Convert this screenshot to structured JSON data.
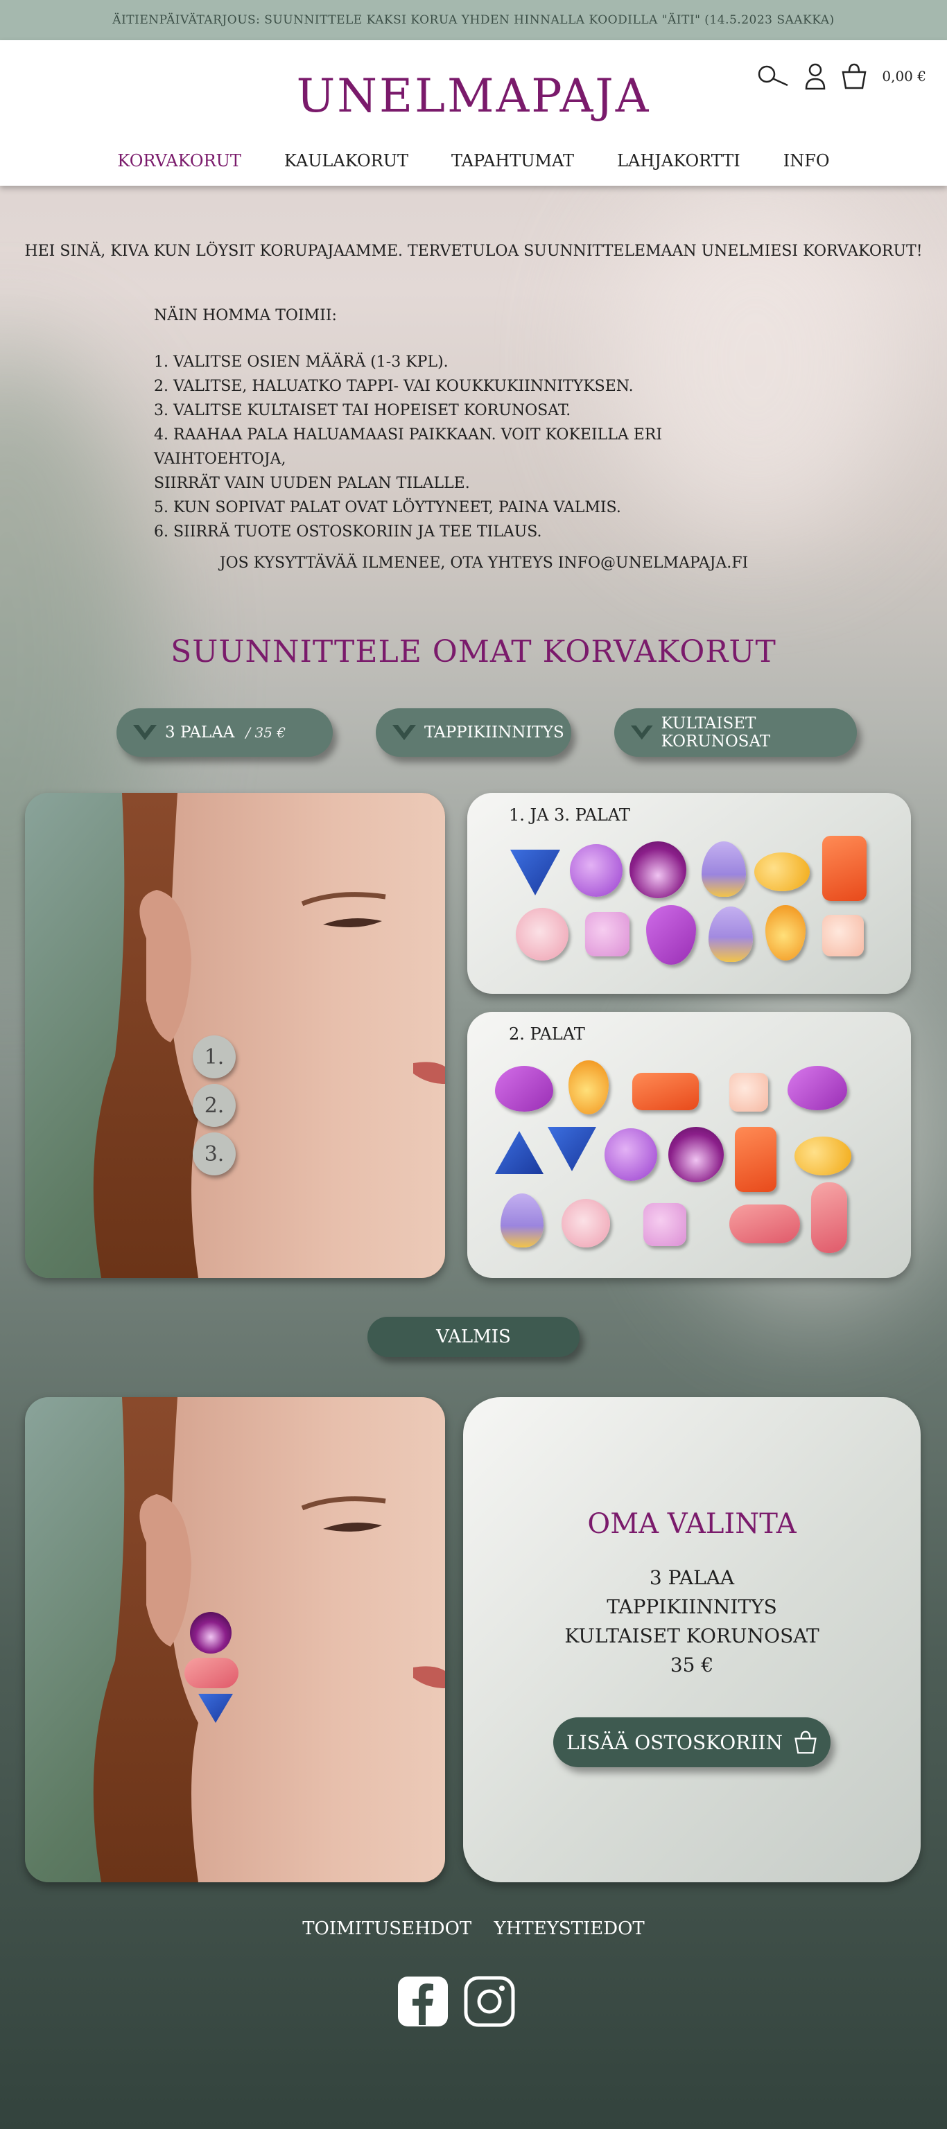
{
  "promo_bar": {
    "text": "Äitienpäivätarjous: Suunnittele kaksi korua yhden hinnalla koodilla \"äiti\" (14.5.2023 saakka)"
  },
  "header": {
    "logo": "UNELMAPAJA",
    "cart_total": "0,00 €",
    "icons": [
      "search-icon",
      "user-icon",
      "basket-icon"
    ]
  },
  "nav": {
    "items": [
      {
        "label": "Korvakorut",
        "active": true
      },
      {
        "label": "Kaulakorut",
        "active": false
      },
      {
        "label": "Tapahtumat",
        "active": false
      },
      {
        "label": "Lahjakortti",
        "active": false
      },
      {
        "label": "Info",
        "active": false
      }
    ]
  },
  "intro": {
    "text": "Hei sinä, kiva kun löysit korupajaamme. Tervetuloa suunnittelemaan unelmiesi korvakorut!"
  },
  "howto": {
    "heading": "Näin homma toimii:",
    "steps": [
      "1.   Valitse osien määrä (1-3 kpl).",
      "2.  Valitse, haluatko tappi- vai koukkukiinnityksen.",
      "3.  Valitse kultaiset tai hopeiset korunosat.",
      "4.  Raahaa pala haluamaasi paikkaan. Voit kokeilla eri vaihtoehtoja,",
      "siirrät vain uuden palan tilalle.",
      "5.   Kun sopivat palat ovat löytyneet, paina valmis.",
      "6.   Siirrä tuote ostoskoriin ja tee tilaus."
    ]
  },
  "contact": {
    "text": "Jos kysyttävää ilmenee, ota yhteys info@unelmapaja.fi"
  },
  "designer": {
    "title": "Suunnittele omat korvakorut",
    "options": [
      {
        "label": "3 palaa",
        "price": "/ 35 €"
      },
      {
        "label": "Tappikiinnitys"
      },
      {
        "label": "Kultaiset korunosat"
      }
    ],
    "slots": [
      "1.",
      "2.",
      "3."
    ],
    "palette_1_3_title": "1. ja 3. palat",
    "palette_2_title": "2. palat",
    "ready_button": "Valmis"
  },
  "summary": {
    "title": "Oma valinta",
    "lines": [
      "3 palaa",
      "Tappikiinnitys",
      "Kultaiset korunosat",
      "35 €"
    ],
    "add_to_cart": "Lisää ostoskoriin"
  },
  "footer": {
    "links": [
      "Toimitusehdot",
      "Yhteystiedot"
    ],
    "social": [
      "facebook-icon",
      "instagram-icon"
    ]
  },
  "colors": {
    "brand": "#7a1a6b",
    "button_dark": "#3e5a50",
    "button_option": "#5f7a70",
    "promo_bar": "#a5b8ae"
  }
}
